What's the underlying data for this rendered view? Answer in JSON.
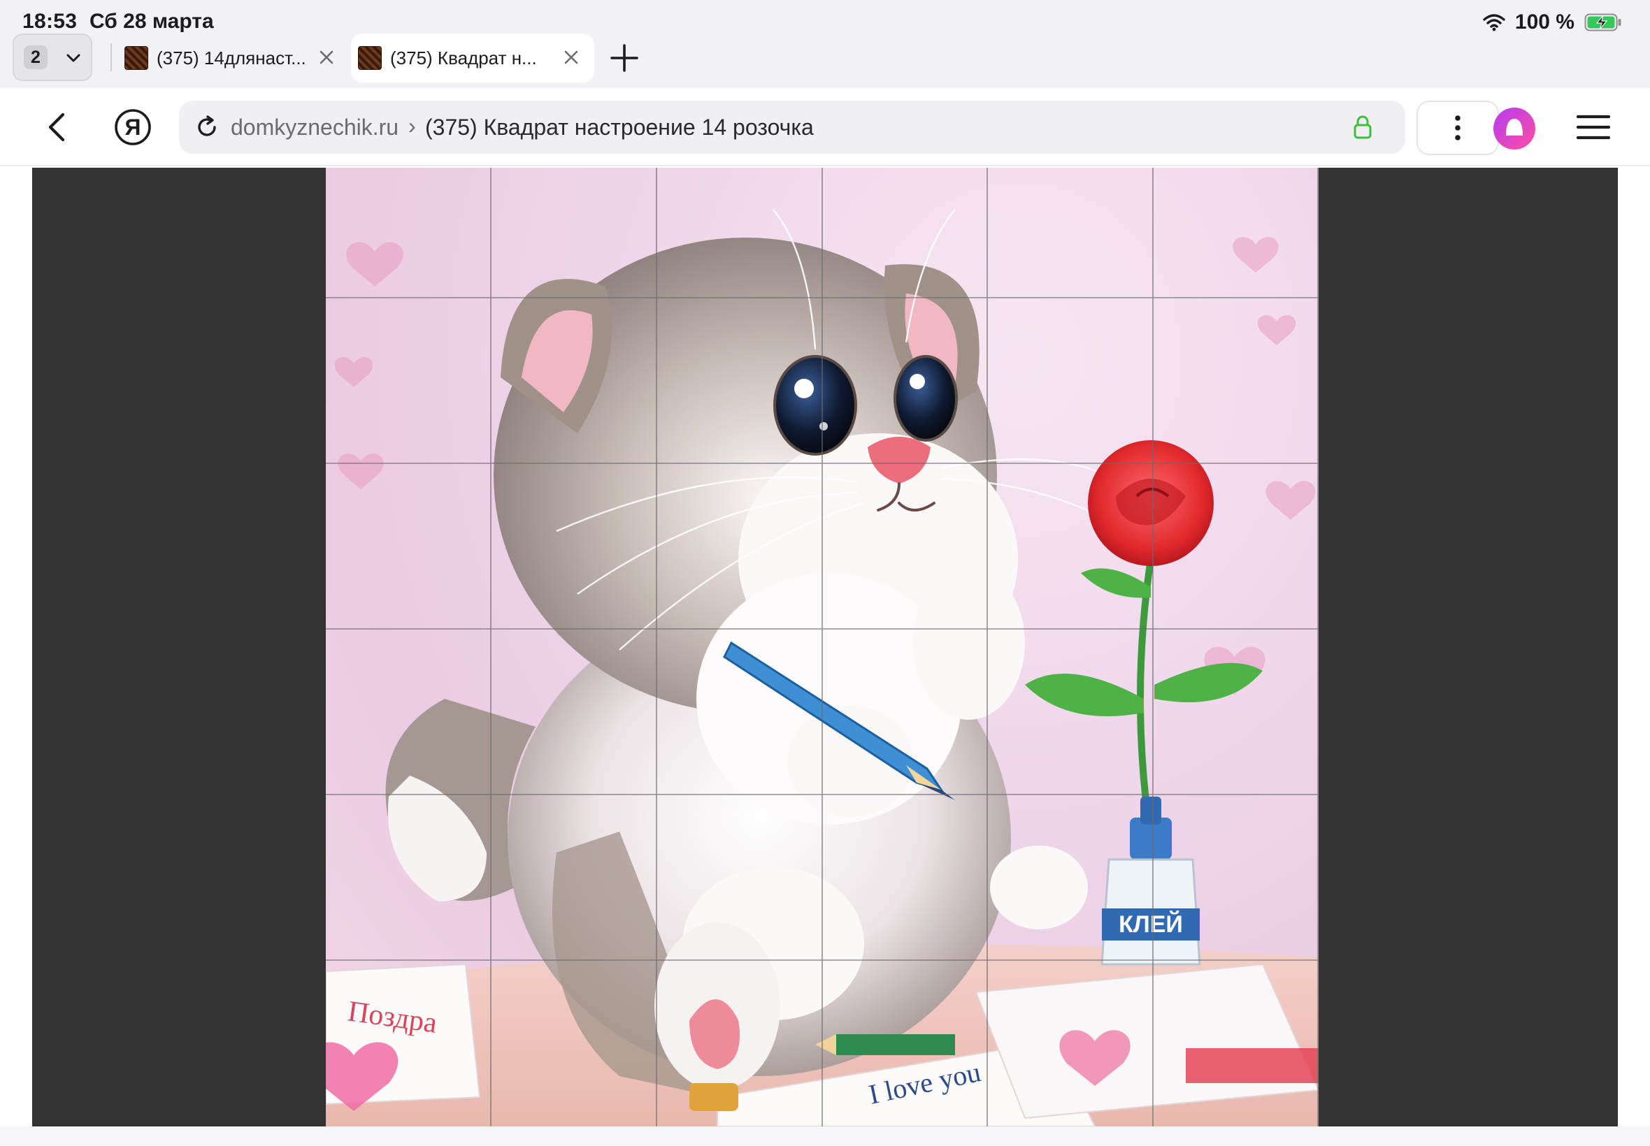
{
  "status_bar": {
    "time": "18:53",
    "date": "Сб 28 марта",
    "battery_percent": "100 %",
    "charging": true
  },
  "tabs": {
    "count": "2",
    "items": [
      {
        "title": "(375) 14длянаст...",
        "active": false
      },
      {
        "title": "(375) Квадрат н...",
        "active": true
      }
    ]
  },
  "address_bar": {
    "domain": "domkyznechik.ru",
    "separator": "›",
    "page_title": "(375) Квадрат настроение 14 розочка",
    "secure": true
  },
  "image": {
    "grid_columns": 6,
    "grid_rows": 6,
    "bottle_label": "КЛЕЙ",
    "card_text": "Поздра",
    "note_text": "I love you"
  },
  "colors": {
    "accent_lock": "#3cc03c",
    "alice_gradient_start": "#b23cf0",
    "alice_gradient_end": "#ff4fa3",
    "viewer_bg": "#333333"
  },
  "icons": [
    "chevron-down-icon",
    "close-icon",
    "plus-icon",
    "back-icon",
    "yandex-icon",
    "reload-icon",
    "lock-icon",
    "more-vertical-icon",
    "alice-icon",
    "hamburger-icon",
    "wifi-icon",
    "battery-icon"
  ]
}
